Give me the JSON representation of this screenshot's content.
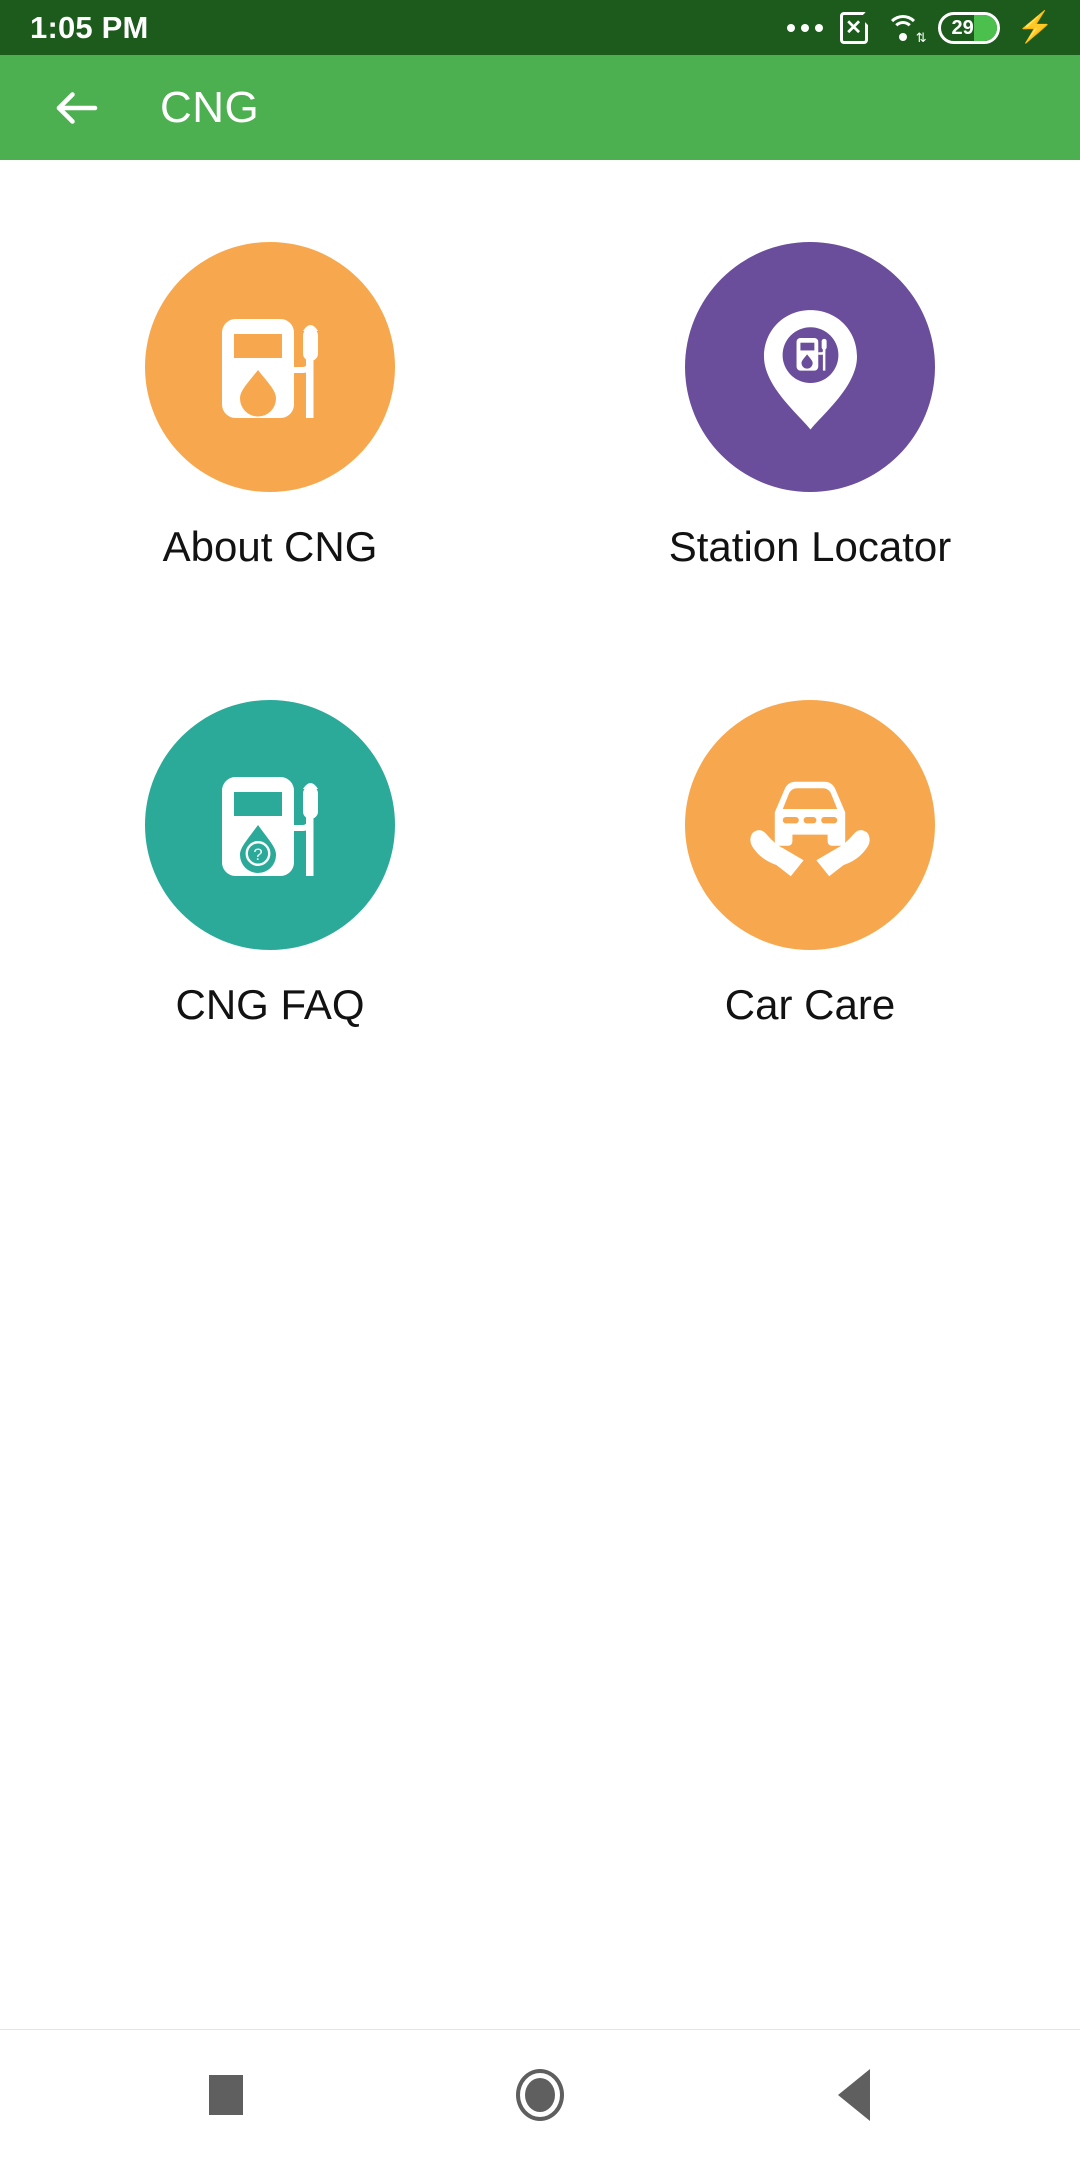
{
  "status_bar": {
    "time": "1:05 PM",
    "battery_percent": "29",
    "battery_level": 29,
    "icons": [
      "more-dots-icon",
      "sim-card-x-icon",
      "wifi-icon",
      "battery-icon",
      "charging-bolt-icon"
    ],
    "background_color": "#1D5B1D",
    "foreground_color": "#FFFFFF"
  },
  "app_bar": {
    "title": "CNG",
    "back_icon": "back-arrow-icon",
    "background_color": "#4CAF50",
    "text_color": "#FFFFFF"
  },
  "menu": {
    "tiles": [
      {
        "label": "About CNG",
        "icon": "fuel-pump-icon",
        "circle_color": "#F7A84E",
        "glyph_color": "#FFFFFF"
      },
      {
        "label": "Station Locator",
        "icon": "map-pin-fuel-pump-icon",
        "circle_color": "#6B4E9B",
        "glyph_color": "#FFFFFF"
      },
      {
        "label": "CNG FAQ",
        "icon": "fuel-pump-question-icon",
        "circle_color": "#2BAA99",
        "glyph_color": "#FFFFFF"
      },
      {
        "label": "Car Care",
        "icon": "car-in-hands-icon",
        "circle_color": "#F7A84E",
        "glyph_color": "#FFFFFF"
      }
    ],
    "label_color": "#121212",
    "background_color": "#FFFFFF"
  },
  "nav_bar": {
    "buttons": [
      {
        "name": "recents-button",
        "icon": "square-icon"
      },
      {
        "name": "home-button",
        "icon": "circle-icon"
      },
      {
        "name": "back-button",
        "icon": "triangle-left-icon"
      }
    ],
    "icon_color": "#5F5F5F",
    "background_color": "#FFFFFF"
  }
}
